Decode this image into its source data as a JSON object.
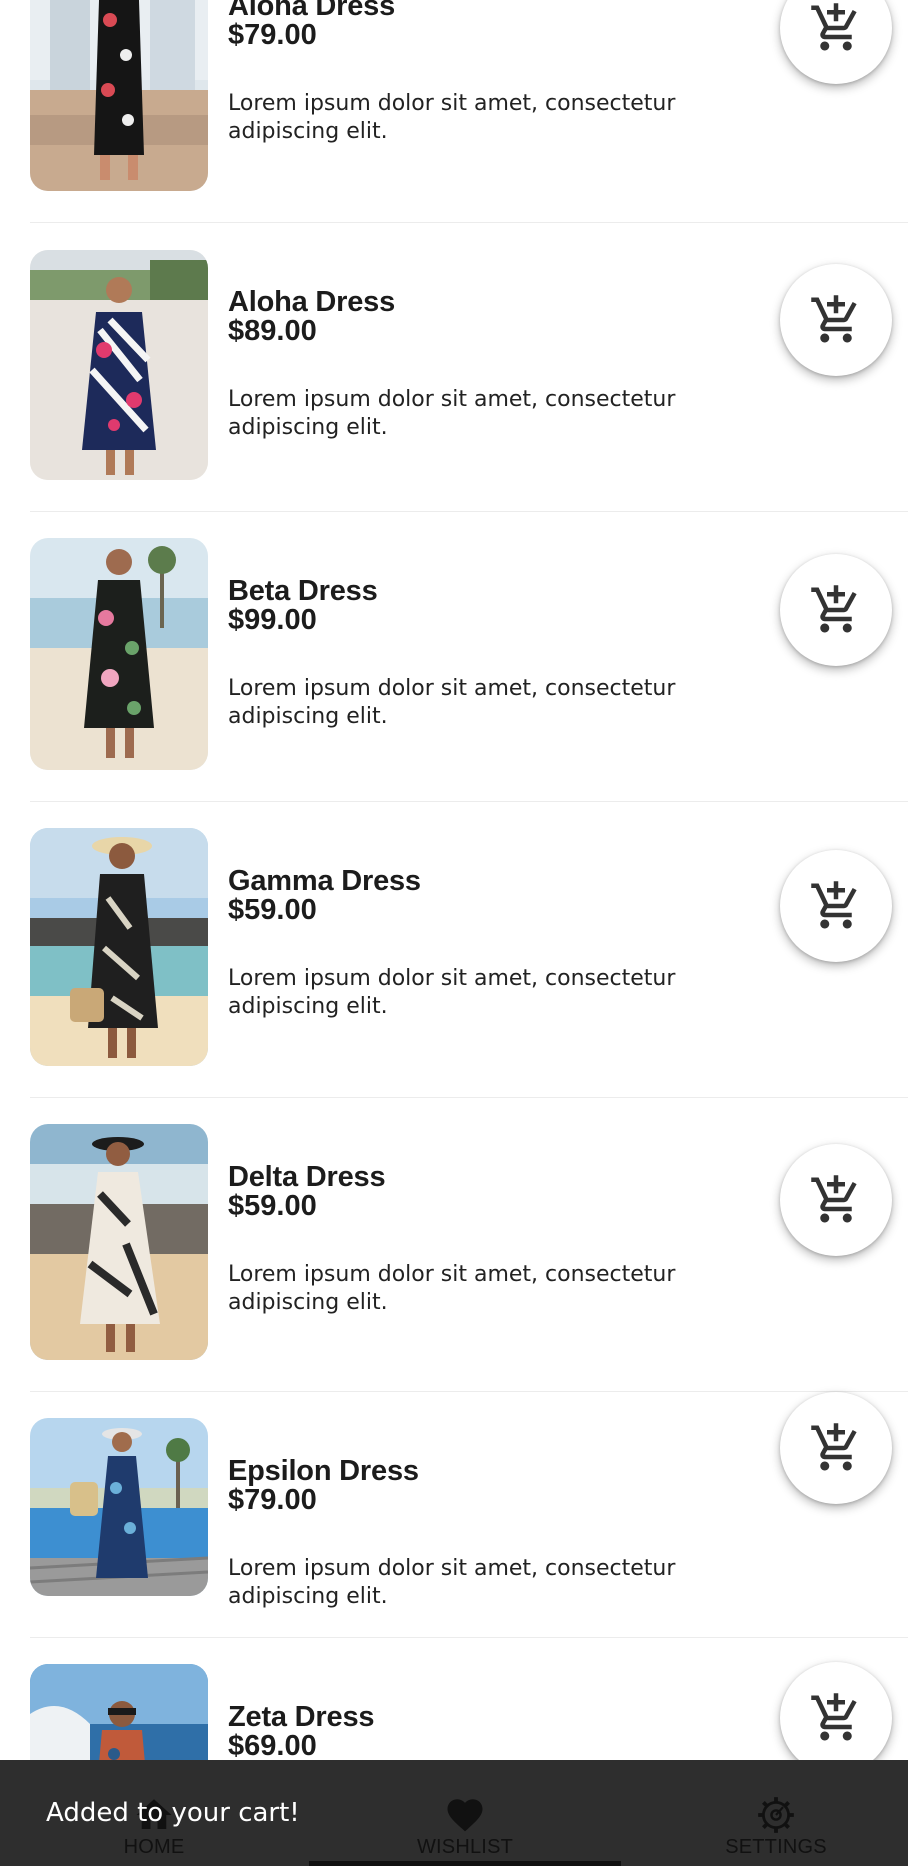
{
  "products": [
    {
      "name": "Aloha Dress",
      "price": "$79.00",
      "description": "Lorem ipsum dolor sit amet, consectetur adipiscing elit.",
      "cart_icon": "add-shopping-cart-icon"
    },
    {
      "name": "Aloha Dress",
      "price": "$89.00",
      "description": "Lorem ipsum dolor sit amet, consectetur adipiscing elit.",
      "cart_icon": "add-shopping-cart-icon"
    },
    {
      "name": "Beta Dress",
      "price": "$99.00",
      "description": "Lorem ipsum dolor sit amet, consectetur adipiscing elit.",
      "cart_icon": "add-shopping-cart-icon"
    },
    {
      "name": "Gamma Dress",
      "price": "$59.00",
      "description": "Lorem ipsum dolor sit amet, consectetur adipiscing elit.",
      "cart_icon": "add-shopping-cart-icon"
    },
    {
      "name": "Delta Dress",
      "price": "$59.00",
      "description": "Lorem ipsum dolor sit amet, consectetur adipiscing elit.",
      "cart_icon": "add-shopping-cart-icon"
    },
    {
      "name": "Epsilon Dress",
      "price": "$79.00",
      "description": "Lorem ipsum dolor sit amet, consectetur adipiscing elit.",
      "cart_icon": "add-shopping-cart-icon"
    },
    {
      "name": "Zeta Dress",
      "price": "$69.00",
      "description": "",
      "cart_icon": "add-shopping-cart-icon"
    }
  ],
  "bottom_nav": {
    "items": [
      {
        "label": "HOME",
        "icon": "home-icon"
      },
      {
        "label": "WISHLIST",
        "icon": "heart-icon",
        "selected": true
      },
      {
        "label": "SETTINGS",
        "icon": "gear-icon"
      }
    ]
  },
  "snackbar": {
    "message": "Added to your cart!"
  },
  "colors": {
    "nav_background": "#2e2e2e",
    "text_primary": "#1c1c1c",
    "divider": "#ececec",
    "cart_icon": "#333333"
  }
}
